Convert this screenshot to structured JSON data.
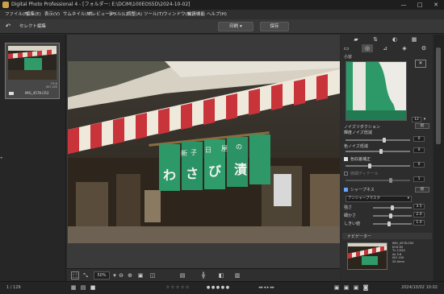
{
  "window": {
    "title": "Digital Photo Professional 4 - [フォルダー: E:\\DCIM\\100EOS5D\\2024-10-02]"
  },
  "menu": [
    "ファイル(F)",
    "編集(E)",
    "表示(V)",
    "サムネイル(M)",
    "プレビュー(P)",
    "ラベル(L)",
    "調整(A)",
    "ツール(T)",
    "ウィンドウ(W)",
    "拡張機能",
    "ヘルプ(H)"
  ],
  "toolbar": {
    "back_label": "↶",
    "select_edit_label": "セレクト編集",
    "print_label": "印刷",
    "save_label": "保存"
  },
  "thumbnail": {
    "filename": "IMG_4578.CR3",
    "info1": "F5.6",
    "info2": "ISO 100"
  },
  "right_panel": {
    "section_title": "小窓",
    "zoom_value": "12",
    "noise_header": "ノイズリダクション",
    "luma_label": "輝度ノイズ低減",
    "luma_value": "0",
    "chroma_label": "色ノイズ低減",
    "chroma_value": "0",
    "color_fringe_label": "色収差補正",
    "color_fringe_value": "0",
    "fine_label": "微細ディテール",
    "fine_value": "1",
    "sharpness_header": "シャープネス",
    "sharp_mode": "アンシャープマスク",
    "strength_label": "強さ",
    "strength_value": "3.5",
    "fineness_label": "細かさ",
    "fineness_value": "2.0",
    "threshold_label": "しきい値",
    "threshold_value": "1.0",
    "reset_label": "初",
    "navigator_header": "ナビゲーター",
    "nav_info": [
      "IMG_4578.CR3",
      "EOS R5",
      "Tv 1/320",
      "Av 5.6",
      "ISO 100",
      "55.0mm"
    ]
  },
  "bottom": {
    "zoom": "50%"
  },
  "status": {
    "left": "1 / 129",
    "right": "2024/10/02 10:02"
  }
}
